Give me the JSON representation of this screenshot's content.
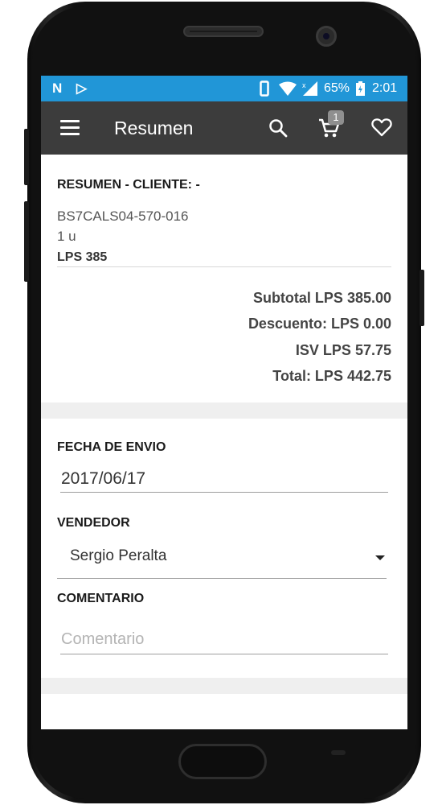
{
  "status_bar": {
    "left_icons": [
      "N",
      "▷"
    ],
    "battery": "65%",
    "time": "2:01"
  },
  "toolbar": {
    "title": "Resumen",
    "cart_count": "1"
  },
  "summary": {
    "heading": "RESUMEN - CLIENTE:  -",
    "item_code": "BS7CALS04-570-016",
    "item_qty": "1 u",
    "item_price": "LPS 385",
    "subtotal": "Subtotal LPS 385.00",
    "discount": "Descuento: LPS 0.00",
    "isv": "ISV LPS 57.75",
    "total": "Total: LPS 442.75"
  },
  "form": {
    "ship_date_label": "FECHA DE ENVIO",
    "ship_date_value": "2017/06/17",
    "seller_label": "VENDEDOR",
    "seller_value": "Sergio Peralta",
    "comment_label": "COMENTARIO",
    "comment_placeholder": "Comentario"
  },
  "colors": {
    "status_bar": "#2196d7",
    "toolbar": "#3c3c3c"
  }
}
